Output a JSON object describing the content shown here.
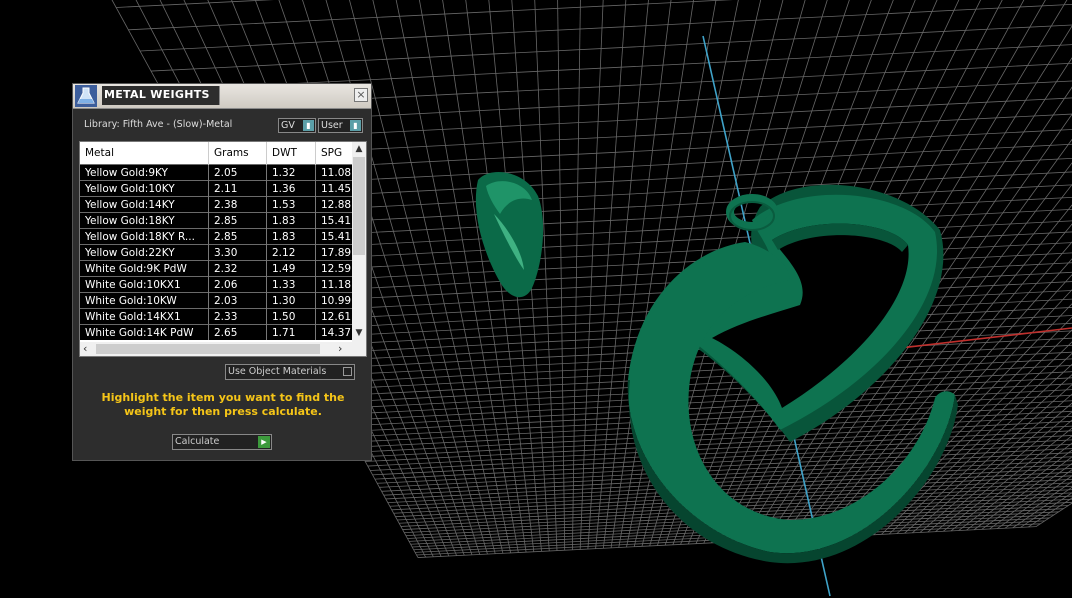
{
  "dialog": {
    "title": "METAL WEIGHTS",
    "close_glyph": "×",
    "library_label": "Library: Fifth Ave - (Slow)-Metal",
    "gv_option": "GV",
    "user_option": "User",
    "use_object_materials_label": "Use Object Materials",
    "hint_text": "Highlight the item you want to find the weight for then press calculate.",
    "calculate_label": "Calculate"
  },
  "table": {
    "headers": [
      "Metal",
      "Grams",
      "DWT",
      "SPG"
    ],
    "rows": [
      [
        "Yellow Gold:9KY",
        "2.05",
        "1.32",
        "11.08"
      ],
      [
        "Yellow Gold:10KY",
        "2.11",
        "1.36",
        "11.45"
      ],
      [
        "Yellow Gold:14KY",
        "2.38",
        "1.53",
        "12.88"
      ],
      [
        "Yellow Gold:18KY",
        "2.85",
        "1.83",
        "15.41"
      ],
      [
        "Yellow Gold:18KY R...",
        "2.85",
        "1.83",
        "15.41"
      ],
      [
        "Yellow Gold:22KY",
        "3.30",
        "2.12",
        "17.89"
      ],
      [
        "White Gold:9K PdW",
        "2.32",
        "1.49",
        "12.59"
      ],
      [
        "White Gold:10KX1",
        "2.06",
        "1.33",
        "11.18"
      ],
      [
        "White Gold:10KW",
        "2.03",
        "1.30",
        "10.99"
      ],
      [
        "White Gold:14KX1",
        "2.33",
        "1.50",
        "12.61"
      ],
      [
        "White Gold:14K PdW",
        "2.65",
        "1.71",
        "14.37"
      ]
    ]
  },
  "colors": {
    "model_green": "#0e7350",
    "hint_yellow": "#f5c518",
    "grid": "#8a8a8a"
  }
}
